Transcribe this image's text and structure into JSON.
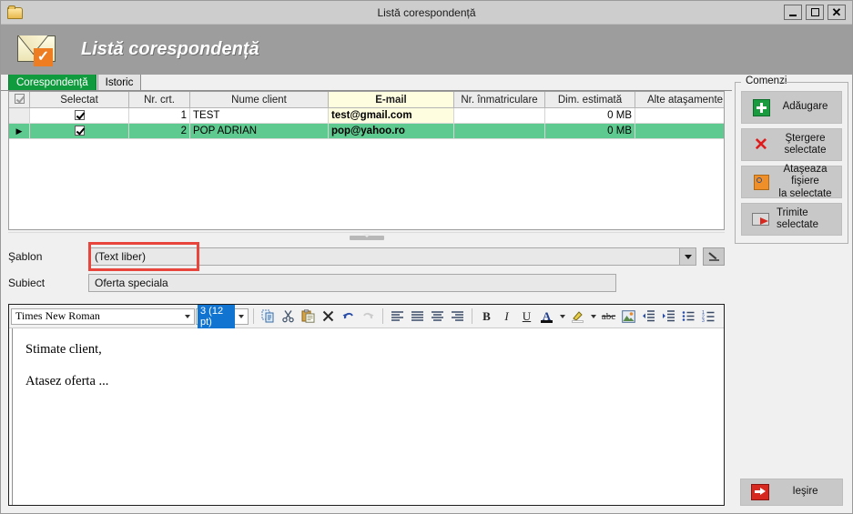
{
  "window": {
    "title": "Listă corespondență",
    "icon": "folder-icon",
    "controls": {
      "minimize": "_",
      "maximize": "□",
      "close": "✕"
    }
  },
  "banner": {
    "title": "Listă corespondență",
    "icon": "envelope-check-icon"
  },
  "tabs": [
    {
      "label": "Corespondenţă",
      "active": true
    },
    {
      "label": "Istoric",
      "active": false
    }
  ],
  "grid": {
    "columns": [
      "Selectat",
      "Nr. crt.",
      "Nume client",
      "E-mail",
      "Nr. înmatriculare",
      "Dim. estimată",
      "Alte ataşamente"
    ],
    "rows": [
      {
        "indicator": "",
        "selected": true,
        "nr": "1",
        "nume": "TEST",
        "email": "test@gmail.com",
        "inmatriculare": "",
        "dim": "0 MB",
        "alte": "",
        "highlight": false
      },
      {
        "indicator": "▶",
        "selected": true,
        "nr": "2",
        "nume": "POP ADRIAN",
        "email": "pop@yahoo.ro",
        "inmatriculare": "",
        "dim": "0 MB",
        "alte": "",
        "highlight": true
      }
    ],
    "row_actions": [
      "attach-file-icon",
      "edit-pencil-icon",
      "delete-x-icon"
    ]
  },
  "form": {
    "sablon_label": "Şablon",
    "sablon_value": "(Text liber)",
    "subiect_label": "Subiect",
    "subiect_value": "Oferta speciala",
    "edit_template_icon": "edit-pencil-icon"
  },
  "editor": {
    "font_name": "Times New Roman",
    "font_size": "3 (12 pt)",
    "body_lines": [
      "Stimate client,",
      "Atasez oferta ..."
    ],
    "toolbar_icons": [
      "copy-icon",
      "cut-icon",
      "paste-icon",
      "delete-icon",
      "undo-icon",
      "redo-icon",
      "align-left-icon",
      "align-justify-icon",
      "align-center-icon",
      "align-right-icon",
      "bold-icon",
      "italic-icon",
      "underline-icon",
      "font-color-icon",
      "font-color-dropdown-icon",
      "highlight-color-icon",
      "highlight-color-dropdown-icon",
      "strikethrough-icon",
      "insert-image-icon",
      "decrease-indent-icon",
      "increase-indent-icon",
      "bullet-list-icon",
      "numbered-list-icon"
    ],
    "bold_label": "B",
    "italic_label": "I",
    "underline_label": "U",
    "strike_label": "abc",
    "font_color_label": "A"
  },
  "commands": {
    "legend": "Comenzi",
    "buttons": [
      {
        "label": "Adăugare",
        "icon": "add-plus-icon",
        "align": "center"
      },
      {
        "label": "Ştergere\nselectate",
        "icon": "delete-x-icon",
        "align": "center"
      },
      {
        "label": "Ataşeaza fişiere\nla selectate",
        "icon": "attach-file-icon",
        "align": "center"
      },
      {
        "label": "Trimite selectate",
        "icon": "send-mail-icon",
        "align": "left"
      }
    ],
    "exit": {
      "label": "Ieşire",
      "icon": "exit-door-icon"
    }
  },
  "colors": {
    "accent_green": "#0f9b3e",
    "row_highlight": "#5fca90",
    "email_column": "#fffde0",
    "banner": "#9d9d9d",
    "highlight_outline": "#e8453c",
    "danger_red": "#e01b1b"
  }
}
